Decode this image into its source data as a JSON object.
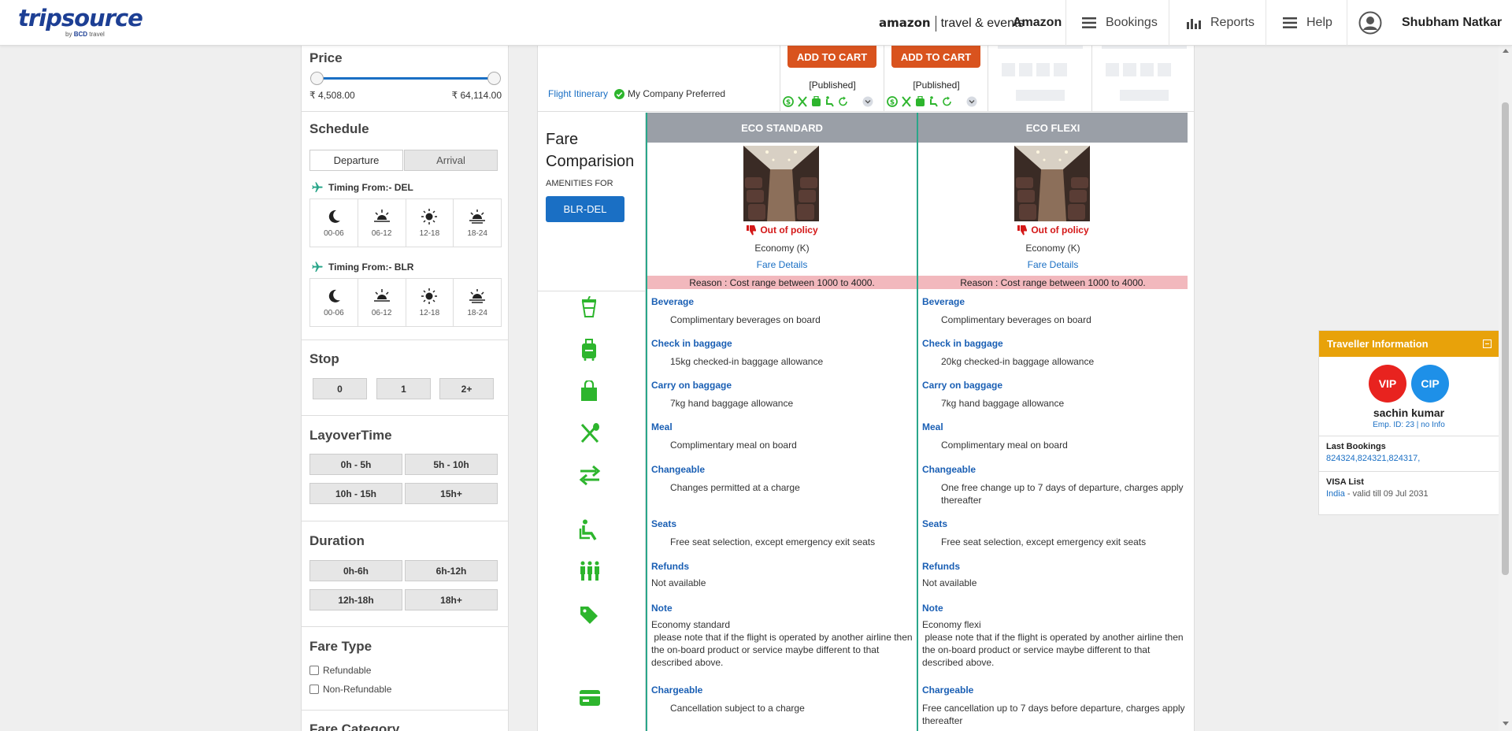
{
  "header": {
    "logo_text": "tripsource",
    "logo_sub_by": "by",
    "logo_sub_brand": "BCD",
    "logo_sub_travel": "travel",
    "partner_brand": "amazon",
    "partner_text": "travel & events",
    "client_name": "Amazon",
    "nav": [
      {
        "label": "Bookings",
        "icon": "list-icon"
      },
      {
        "label": "Reports",
        "icon": "bar-chart-icon"
      },
      {
        "label": "Help",
        "icon": "menu-icon"
      }
    ],
    "user_name": "Shubham Natkar"
  },
  "filters": {
    "price": {
      "title": "Price",
      "min_label": "₹ 4,508.00",
      "max_label": "₹ 64,114.00"
    },
    "schedule": {
      "title": "Schedule",
      "tabs": [
        "Departure",
        "Arrival"
      ],
      "active_tab": "Departure",
      "groups": [
        {
          "label": "Timing From:- DEL"
        },
        {
          "label": "Timing From:- BLR"
        }
      ],
      "slots": [
        "00-06",
        "06-12",
        "12-18",
        "18-24"
      ]
    },
    "stop": {
      "title": "Stop",
      "options": [
        "0",
        "1",
        "2+"
      ]
    },
    "layover": {
      "title": "LayoverTime",
      "options": [
        "0h - 5h",
        "5h - 10h",
        "10h - 15h",
        "15h+"
      ]
    },
    "duration": {
      "title": "Duration",
      "options": [
        "0h-6h",
        "6h-12h",
        "12h-18h",
        "18h+"
      ]
    },
    "fare_type": {
      "title": "Fare Type",
      "options": [
        "Refundable",
        "Non-Refundable"
      ]
    },
    "fare_category": {
      "title": "Fare Category"
    }
  },
  "results": {
    "flight_itinerary_link": "Flight Itinerary",
    "company_preferred": "My Company Preferred",
    "add_to_cart": "ADD TO CART",
    "published": "[Published]"
  },
  "comparison": {
    "title_line1": "Fare",
    "title_line2": "Comparision",
    "amenities_for": "AMENITIES FOR",
    "route": "BLR-DEL",
    "amenity_icons": [
      "beverage-icon",
      "checkin-baggage-icon",
      "carry-on-bag-icon",
      "meal-icon",
      "change-icon",
      "seat-icon",
      "refund-icon",
      "note-tag-icon",
      "chargeable-card-icon"
    ],
    "fares": [
      {
        "name": "ECO STANDARD",
        "policy": "Out of policy",
        "cabin": "Economy (K)",
        "fare_details": "Fare Details",
        "reason": "Reason : Cost range between 1000 to 4000.",
        "amenities": [
          {
            "title": "Beverage",
            "desc": "Complimentary beverages on board"
          },
          {
            "title": "Check in baggage",
            "desc": "15kg checked-in baggage allowance"
          },
          {
            "title": "Carry on baggage",
            "desc": "7kg hand baggage allowance"
          },
          {
            "title": "Meal",
            "desc": "Complimentary meal on board"
          },
          {
            "title": "Changeable",
            "desc": "Changes permitted at a charge"
          },
          {
            "title": "Seats",
            "desc": "Free seat selection, except emergency exit seats"
          },
          {
            "title": "Refunds",
            "desc": "Not available"
          },
          {
            "title": "Note",
            "desc": "Economy standard"
          },
          {
            "title": "Chargeable",
            "desc": "Cancellation subject to a charge"
          }
        ],
        "note_extra": " please note that if the flight is operated by another airline then the on-board product or service maybe different to that described above."
      },
      {
        "name": "ECO FLEXI",
        "policy": "Out of policy",
        "cabin": "Economy (K)",
        "fare_details": "Fare Details",
        "reason": "Reason : Cost range between 1000 to 4000.",
        "amenities": [
          {
            "title": "Beverage",
            "desc": "Complimentary beverages on board"
          },
          {
            "title": "Check in baggage",
            "desc": "20kg checked-in baggage allowance"
          },
          {
            "title": "Carry on baggage",
            "desc": "7kg hand baggage allowance"
          },
          {
            "title": "Meal",
            "desc": "Complimentary meal on board"
          },
          {
            "title": "Changeable",
            "desc": "One free change up to 7 days of departure, charges apply thereafter"
          },
          {
            "title": "Seats",
            "desc": "Free seat selection, except emergency exit seats"
          },
          {
            "title": "Refunds",
            "desc": "Not available"
          },
          {
            "title": "Note",
            "desc": "Economy flexi"
          },
          {
            "title": "Chargeable",
            "desc": "Free cancellation up to 7 days before departure, charges apply thereafter"
          }
        ],
        "note_extra": " please note that if the flight is operated by another airline then the on-board product or service maybe different to that described above."
      }
    ]
  },
  "traveller": {
    "title": "Traveller Information",
    "badges": [
      "VIP",
      "CIP"
    ],
    "name": "sachin kumar",
    "emp_prefix": "Emp. ID: 23 | ",
    "emp_info": "no Info",
    "last_bookings_title": "Last Bookings",
    "last_bookings": "824324,824321,824317,",
    "visa_title": "VISA List",
    "visa_country": "India",
    "visa_text": " - valid till 09 Jul 2031"
  },
  "colors": {
    "brand_blue": "#1d3f94",
    "link_blue": "#1a6fc4",
    "cart_orange": "#d9531e",
    "amenity_green": "#2db52d",
    "policy_red": "#d41818",
    "traveller_orange": "#e8a20a"
  }
}
